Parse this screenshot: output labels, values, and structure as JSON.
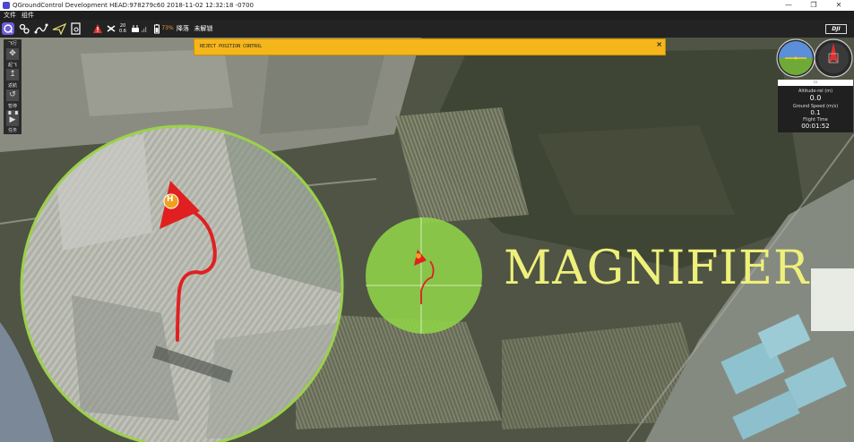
{
  "window": {
    "title": "QGroundControl Development HEAD:978279c60 2018-11-02 12:32:18 -0700",
    "minimize_label": "—",
    "maximize_label": "❐",
    "close_label": "✕"
  },
  "menu": {
    "file": "文件",
    "widgets": "组件"
  },
  "toolbar": {
    "message_count": "20",
    "gps_hdop": "0.6",
    "battery_percent": "73%",
    "flight_mode": "降落",
    "arm_status": "未解锁",
    "brand_logo": "DJI"
  },
  "left_toolbar": {
    "items": [
      {
        "label": "飞行",
        "icon": "plan-icon"
      },
      {
        "label": "起飞",
        "icon": "takeoff-icon"
      },
      {
        "label": "返航",
        "icon": "rtl-icon"
      },
      {
        "label": "暂停",
        "icon": "pause-icon"
      },
      {
        "label": "任务",
        "icon": "mission-icon"
      }
    ]
  },
  "banner": {
    "message": "REJECT POSITION CONTROL",
    "close_label": "×"
  },
  "values_panel": {
    "altitude_label": "Altitude-rel (m)",
    "altitude_value": "0.0",
    "ground_speed_label": "Ground Speed (m/s)",
    "ground_speed_value": "0.1",
    "flight_time_label": "Flight Time",
    "flight_time_value": "00:01:52"
  },
  "map": {
    "home_marker": "H"
  },
  "overlay_caption": "MAGNIFIER",
  "colors": {
    "lens_border": "#9bd14a",
    "track": "#e02020",
    "vehicle": "#e8551e",
    "banner": "#f4b61b",
    "caption": "#eef07a"
  }
}
